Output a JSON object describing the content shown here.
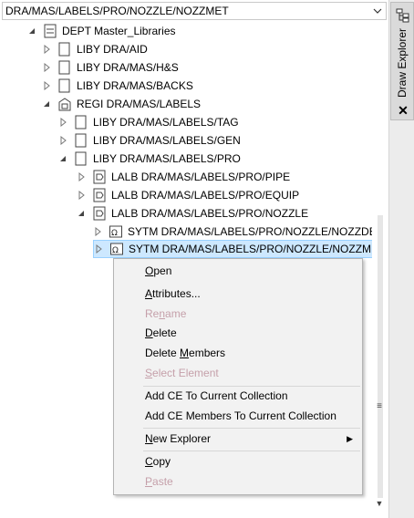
{
  "path_combo": {
    "value": "DRA/MAS/LABELS/PRO/NOZZLE/NOZZMET"
  },
  "dock_tab": {
    "label": "Draw Explorer",
    "icon": "tree-view-icon",
    "close": "✕"
  },
  "tree": {
    "rows": [
      {
        "label": "DEPT Master_Libraries"
      },
      {
        "label": "LIBY DRA/AID"
      },
      {
        "label": "LIBY DRA/MAS/H&S"
      },
      {
        "label": "LIBY DRA/MAS/BACKS"
      },
      {
        "label": "REGI DRA/MAS/LABELS"
      },
      {
        "label": "LIBY DRA/MAS/LABELS/TAG"
      },
      {
        "label": "LIBY DRA/MAS/LABELS/GEN"
      },
      {
        "label": "LIBY DRA/MAS/LABELS/PRO"
      },
      {
        "label": "LALB DRA/MAS/LABELS/PRO/PIPE"
      },
      {
        "label": "LALB DRA/MAS/LABELS/PRO/EQUIP"
      },
      {
        "label": "LALB DRA/MAS/LABELS/PRO/NOZZLE"
      },
      {
        "label": "SYTM DRA/MAS/LABELS/PRO/NOZZLE/NOZZDES"
      },
      {
        "label": "SYTM DRA/MAS/LABELS/PRO/NOZZLE/NOZZMET"
      }
    ]
  },
  "context_menu": {
    "items": [
      {
        "pre": "",
        "u": "O",
        "post": "pen",
        "enabled": true
      },
      {
        "pre": "",
        "u": "A",
        "post": "ttributes...",
        "enabled": true
      },
      {
        "pre": "Re",
        "u": "n",
        "post": "ame",
        "enabled": false
      },
      {
        "pre": "",
        "u": "D",
        "post": "elete",
        "enabled": true
      },
      {
        "pre": "Delete ",
        "u": "M",
        "post": "embers",
        "enabled": true
      },
      {
        "pre": "",
        "u": "S",
        "post": "elect Element",
        "enabled": false
      },
      {
        "pre": "Add CE To Current Collection",
        "u": "",
        "post": "",
        "enabled": true
      },
      {
        "pre": "Add CE Members To Current Collection",
        "u": "",
        "post": "",
        "enabled": true
      },
      {
        "pre": "",
        "u": "N",
        "post": "ew Explorer",
        "enabled": true
      },
      {
        "pre": "",
        "u": "C",
        "post": "opy",
        "enabled": true
      },
      {
        "pre": "",
        "u": "P",
        "post": "aste",
        "enabled": false
      }
    ],
    "submenu_arrow": "▶"
  }
}
